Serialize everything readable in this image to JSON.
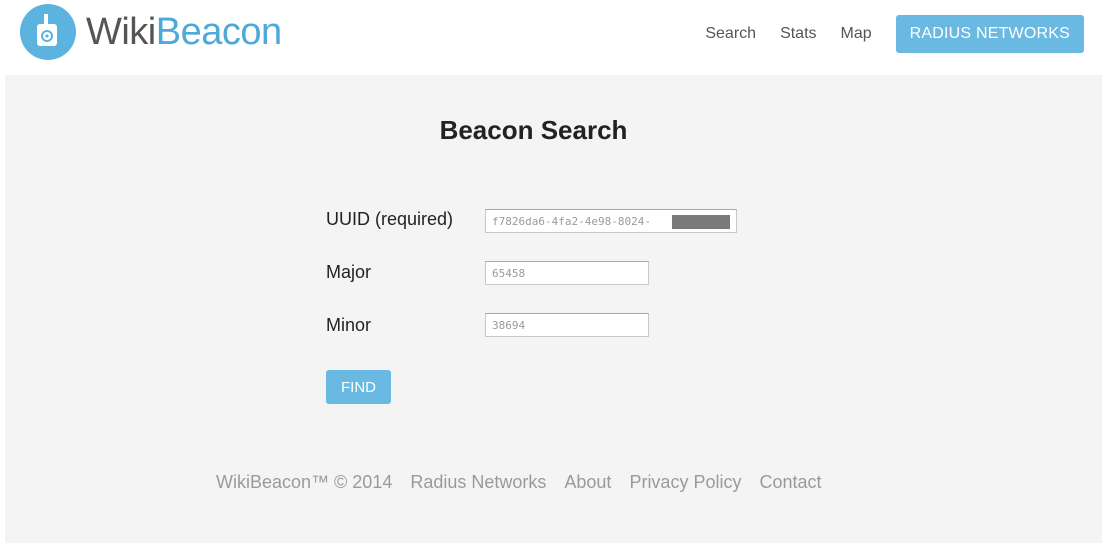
{
  "header": {
    "logo_wiki": "Wiki",
    "logo_beacon": "Beacon",
    "logo_icon": "beacon-device-icon",
    "nav": {
      "search": "Search",
      "stats": "Stats",
      "map": "Map",
      "brand": "RADIUS NETWORKS"
    }
  },
  "main": {
    "title": "Beacon Search",
    "form": {
      "uuid_label": "UUID (required)",
      "uuid_value": "f7826da6-4fa2-4e98-8024-",
      "major_label": "Major",
      "major_value": "65458",
      "minor_label": "Minor",
      "minor_value": "38694",
      "find_label": "FIND"
    }
  },
  "footer": {
    "copyright": "WikiBeacon™ © 2014",
    "radius": "Radius Networks",
    "about": "About",
    "privacy": "Privacy Policy",
    "contact": "Contact"
  },
  "colors": {
    "accent": "#69b9e3",
    "logo_circle": "#5cb3e0",
    "background": "#f4f4f4"
  }
}
